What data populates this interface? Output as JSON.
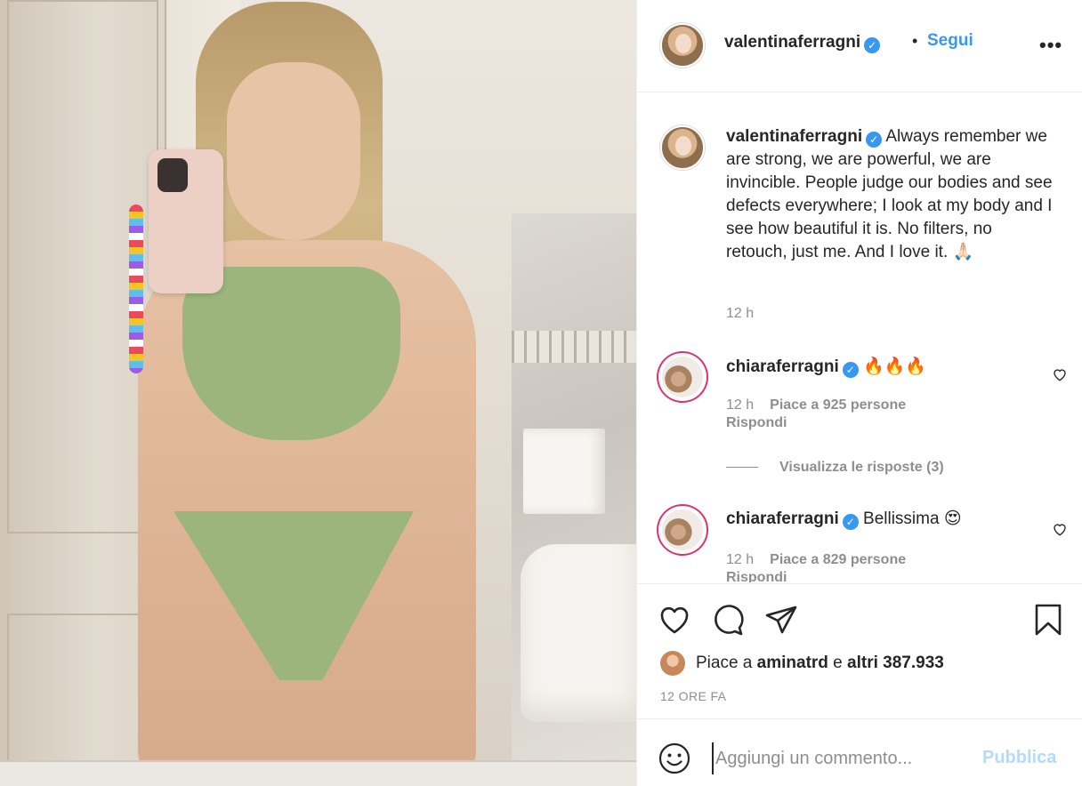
{
  "post": {
    "author": "valentinaferragni",
    "follow_dot": "•",
    "follow_label": "Segui",
    "more_label": "•••",
    "caption": "Always remember we are strong, we are powerful, we are invincible. People judge our bodies and see defects everywhere; I look at my body and I see how beautiful it is. No filters, no retouch, just me. And I love it. 🙏🏻",
    "caption_time": "12 h"
  },
  "comments": [
    {
      "user": "chiaraferragni",
      "text": "🔥🔥🔥",
      "time": "12 h",
      "likes": "Piace a 925 persone",
      "reply": "Rispondi",
      "view_replies": "Visualizza le risposte (3)"
    },
    {
      "user": "chiaraferragni",
      "text": "Bellissima 😍",
      "time": "12 h",
      "likes": "Piace a 829 persone",
      "reply": "Rispondi"
    }
  ],
  "likes_summary": {
    "prefix": "Piace a ",
    "first_user": "aminatrd",
    "middle": " e ",
    "others": "altri 387.933"
  },
  "age": "12 ORE FA",
  "comment_box": {
    "placeholder": "Aggiungi un commento...",
    "publish_label": "Pubblica"
  },
  "icons": {
    "like": "heart-icon",
    "comment": "comment-icon",
    "share": "share-icon",
    "save": "bookmark-icon",
    "emoji": "emoji-icon",
    "verified": "verified-badge-icon"
  },
  "colors": {
    "link_blue": "#3897f0",
    "publish_disabled": "#b3dbff",
    "secondary_text": "#8e8e8e",
    "story_ring": "#e1306c"
  }
}
